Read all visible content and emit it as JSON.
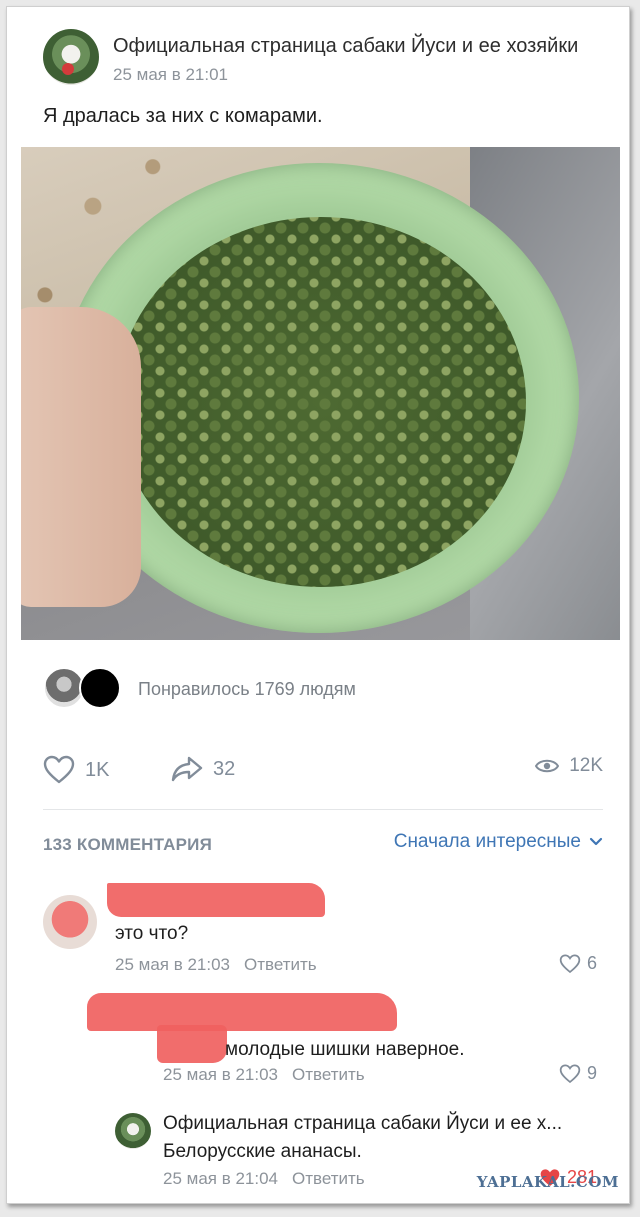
{
  "post": {
    "author": "Официальная страница сабаки Йуси и ее хозяйки",
    "date": "25 мая в 21:01",
    "text": "Я дралась за них с комарами."
  },
  "likes": {
    "text": "Понравилось 1769 людям"
  },
  "actions": {
    "like_count": "1K",
    "share_count": "32",
    "views_count": "12K"
  },
  "comments_header": {
    "count_label": "133 КОММЕНТАРИЯ",
    "sort_label": "Сначала интересные"
  },
  "comments": [
    {
      "text": "это что?",
      "date": "25 мая в 21:03",
      "reply_label": "Ответить",
      "likes": "6"
    },
    {
      "text": "молодые шишки наверное.",
      "date": "25 мая в 21:03",
      "reply_label": "Ответить",
      "likes": "9"
    },
    {
      "author": "Официальная страница сабаки Йуси и ее х...",
      "text": "Белорусские ананасы.",
      "date": "25 мая в 21:04",
      "reply_label": "Ответить",
      "likes": "281"
    }
  ],
  "watermark": "YAPLAKAL.COM",
  "colors": {
    "link_blue": "#3f76b5",
    "muted_gray": "#818c99",
    "redaction": "#f0615f",
    "liked_red": "#e64646"
  }
}
